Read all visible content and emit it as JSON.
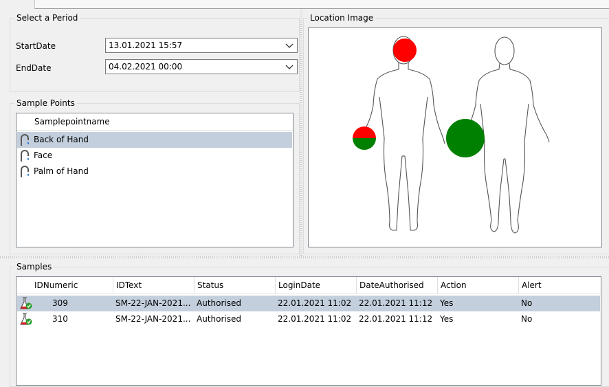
{
  "period": {
    "title": "Select a Period",
    "start_label": "StartDate",
    "start_value": "13.01.2021 15:57",
    "end_label": "EndDate",
    "end_value": "04.02.2021 00:00"
  },
  "sample_points": {
    "title": "Sample Points",
    "column": "Samplepointname",
    "items": [
      {
        "name": "Back of Hand",
        "selected": true
      },
      {
        "name": "Face",
        "selected": false
      },
      {
        "name": "Palm of Hand",
        "selected": false
      }
    ]
  },
  "location_image": {
    "title": "Location Image",
    "colors": {
      "red": "#ff0000",
      "green": "#008000"
    }
  },
  "samples": {
    "title": "Samples",
    "columns": [
      "IDNumeric",
      "IDText",
      "Status",
      "LoginDate",
      "DateAuthorised",
      "Action",
      "Alert"
    ],
    "rows": [
      {
        "id_numeric": "309",
        "id_text": "SM-22-JAN-2021...",
        "status": "Authorised",
        "login_date": "22.01.2021 11:02",
        "date_authorised": "22.01.2021 11:12",
        "action": "Yes",
        "alert": "No",
        "selected": true
      },
      {
        "id_numeric": "310",
        "id_text": "SM-22-JAN-2021...",
        "status": "Authorised",
        "login_date": "22.01.2021 11:02",
        "date_authorised": "22.01.2021 11:12",
        "action": "Yes",
        "alert": "No",
        "selected": false
      }
    ]
  }
}
